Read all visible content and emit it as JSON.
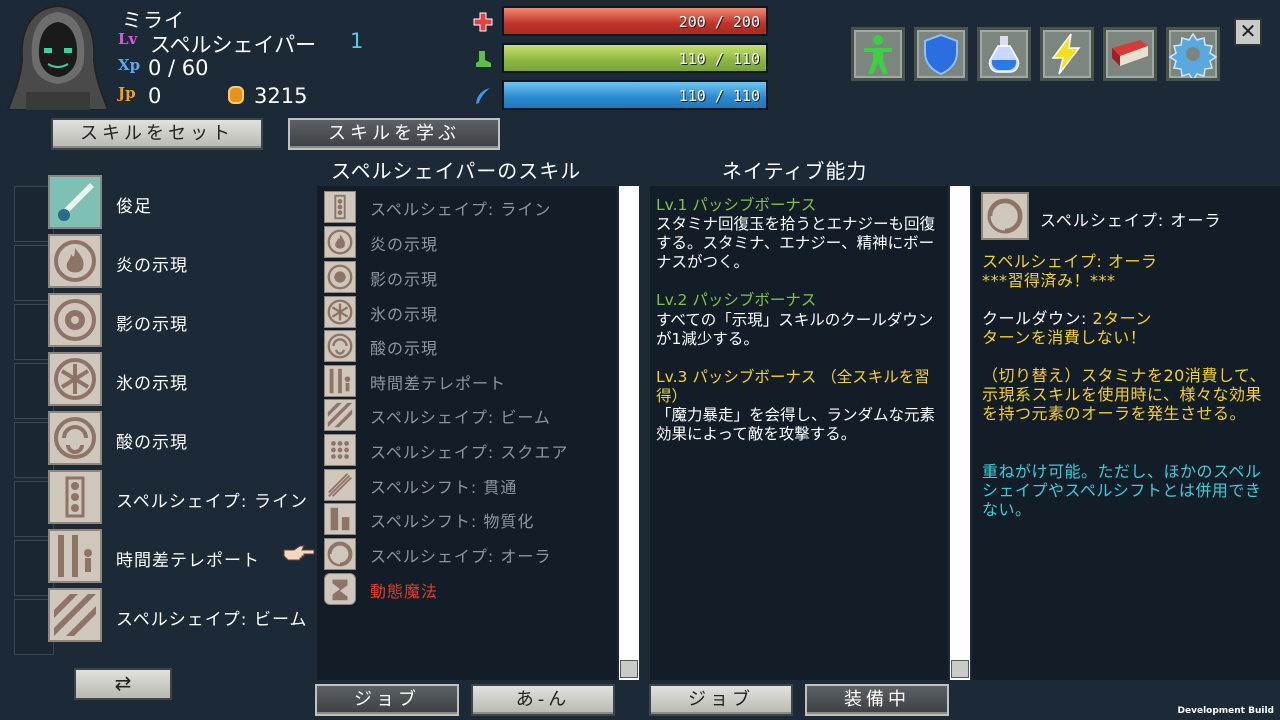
{
  "header": {
    "character_name": "ミライ",
    "lv_icon": "Lv",
    "class_name": "スペルシェイパー",
    "class_level": "1",
    "xp_icon": "Xp",
    "xp": "0 / 60",
    "jp_icon": "Jp",
    "jp": "0",
    "gold": "3215"
  },
  "bars": {
    "hp": {
      "text": "200 / 200",
      "fraction": 1.0,
      "icon": "red-cross-icon"
    },
    "stamina": {
      "text": "110 / 110",
      "fraction": 1.0,
      "icon": "green-boot-icon"
    },
    "mana": {
      "text": "110 / 110",
      "fraction": 1.0,
      "icon": "blue-feather-icon"
    }
  },
  "top_icons": [
    "body-figure-icon",
    "shield-icon",
    "potion-icon",
    "lightning-icon",
    "book-icon",
    "gear-icon"
  ],
  "close_label": "✕",
  "tabs": {
    "set_skill": "スキルをセット",
    "learn_skill": "スキルを学ぶ"
  },
  "headings": {
    "class_skills": "スペルシェイパーのスキル",
    "native": "ネイティブ能力"
  },
  "equipped_slots": [
    {
      "label": "俊足",
      "icon": "swift-feet-icon"
    },
    {
      "label": "炎の示現",
      "icon": "fire-manifest-icon"
    },
    {
      "label": "影の示現",
      "icon": "shadow-manifest-icon"
    },
    {
      "label": "氷の示現",
      "icon": "ice-manifest-icon"
    },
    {
      "label": "酸の示現",
      "icon": "acid-manifest-icon"
    },
    {
      "label": "スペルシェイプ: ライン",
      "icon": "spellshape-line-icon"
    },
    {
      "label": "時間差テレポート",
      "icon": "delayed-teleport-icon"
    },
    {
      "label": "スペルシェイプ: ビーム",
      "icon": "spellshape-beam-icon"
    }
  ],
  "cycle_label": "⇄",
  "skill_list": [
    {
      "label": "スペルシェイプ: ライン",
      "active": false
    },
    {
      "label": "炎の示現",
      "active": false
    },
    {
      "label": "影の示現",
      "active": false
    },
    {
      "label": "氷の示現",
      "active": false
    },
    {
      "label": "酸の示現",
      "active": false
    },
    {
      "label": "時間差テレポート",
      "active": false
    },
    {
      "label": "スペルシェイプ: ビーム",
      "active": false
    },
    {
      "label": "スペルシェイプ: スクエア",
      "active": false
    },
    {
      "label": "スペルシフト: 貫通",
      "active": false
    },
    {
      "label": "スペルシフト: 物質化",
      "active": false
    },
    {
      "label": "スペルシェイプ: オーラ",
      "active": false
    },
    {
      "label": "動態魔法",
      "active": true
    }
  ],
  "native": {
    "lv1_title": "Lv.1 パッシブボーナス",
    "lv1_body": "スタミナ回復玉を拾うとエナジーも回復する。スタミナ、エナジー、精神にボーナスがつく。",
    "lv2_title": "Lv.2 パッシブボーナス",
    "lv2_body": "すべての「示現」スキルのクールダウンが1減少する。",
    "lv3_title": "Lv.3 パッシブボーナス （全スキルを習得）",
    "lv3_body": "「魔力暴走」を会得し、ランダムな元素効果によって敵を攻撃する。"
  },
  "detail": {
    "name": "スペルシェイプ: オーラ",
    "title": "スペルシェイプ: オーラ",
    "learned": "***習得済み！***",
    "cooldown_label": "クールダウン: ",
    "cooldown_value": "2ターン",
    "no_turn": "ターンを消費しない！",
    "desc": "（切り替え）スタミナを20消費して、示現系スキルを使用時に、様々な効果を持つ元素のオーラを発生させる。",
    "note": "重ねがけ可能。ただし、ほかのスペルシェイプやスペルシフトとは併用できない。"
  },
  "bottom_tabs": {
    "list_sort_job": "ジョブ",
    "list_sort_kana": "あ-ん",
    "native_job": "ジョブ",
    "native_equipped": "装備中"
  },
  "dev_build": "Development Build",
  "colors": {
    "background": "#1c2a37",
    "panel": "#121d28",
    "green_heading": "#7fc24a",
    "yellow_text": "#f5d02a",
    "cyan_text": "#38cfd8",
    "active_red": "#e83a2a",
    "dim_list_text": "#8d96a0"
  }
}
